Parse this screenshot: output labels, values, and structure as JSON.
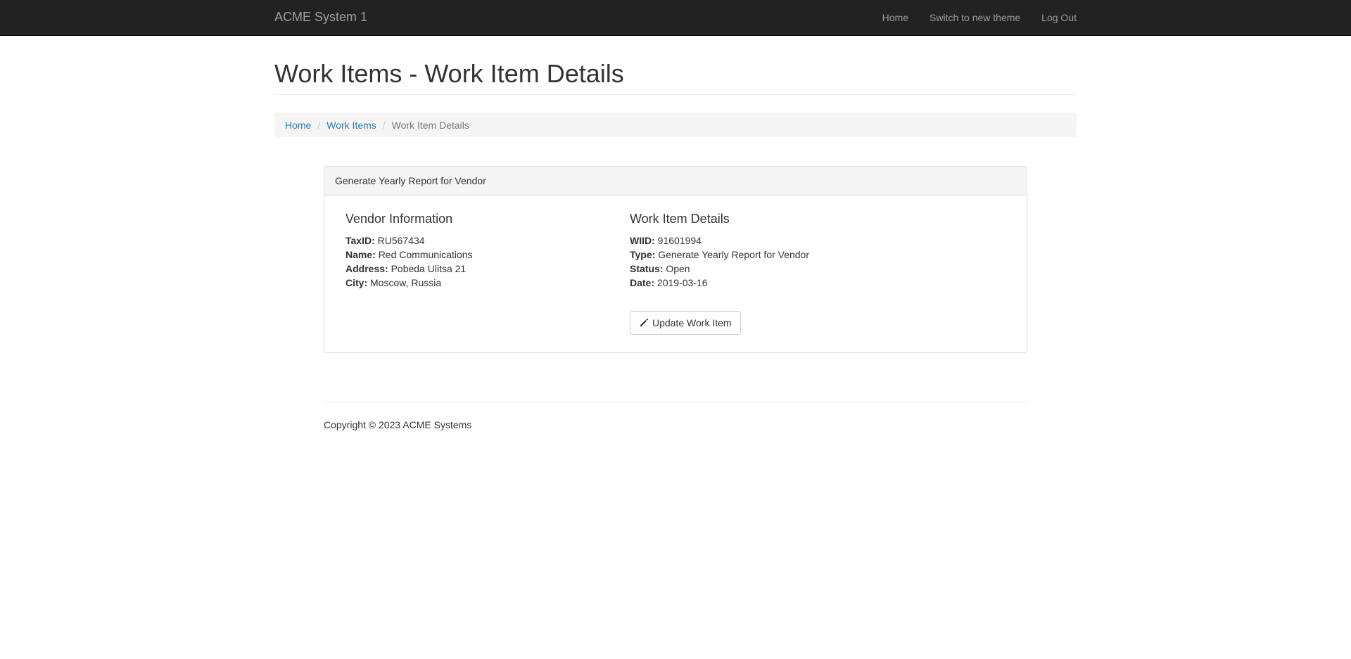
{
  "navbar": {
    "brand": "ACME System 1",
    "links": [
      "Home",
      "Switch to new theme",
      "Log Out"
    ]
  },
  "page": {
    "title": "Work Items - Work Item Details"
  },
  "breadcrumb": {
    "items": [
      "Home",
      "Work Items"
    ],
    "separator": "/",
    "active": "Work Item Details"
  },
  "panel": {
    "heading": "Generate Yearly Report for Vendor",
    "vendor": {
      "title": "Vendor Information",
      "fields": [
        {
          "label": "TaxID:",
          "value": "RU567434"
        },
        {
          "label": "Name:",
          "value": "Red Communications"
        },
        {
          "label": "Address:",
          "value": "Pobeda Ulitsa 21"
        },
        {
          "label": "City:",
          "value": "Moscow, Russia"
        }
      ]
    },
    "work_item": {
      "title": "Work Item Details",
      "fields": [
        {
          "label": "WIID:",
          "value": "91601994"
        },
        {
          "label": "Type:",
          "value": "Generate Yearly Report for Vendor"
        },
        {
          "label": "Status:",
          "value": "Open"
        },
        {
          "label": "Date:",
          "value": "2019-03-16"
        }
      ]
    },
    "update_button": {
      "label": "Update Work Item",
      "icon": "pencil-icon"
    }
  },
  "footer": {
    "text": "Copyright © 2023 ACME Systems"
  },
  "colors": {
    "navbar_bg": "#222222",
    "navbar_text": "#9d9d9d",
    "link": "#337ab7",
    "breadcrumb_bg": "#f5f5f5"
  }
}
